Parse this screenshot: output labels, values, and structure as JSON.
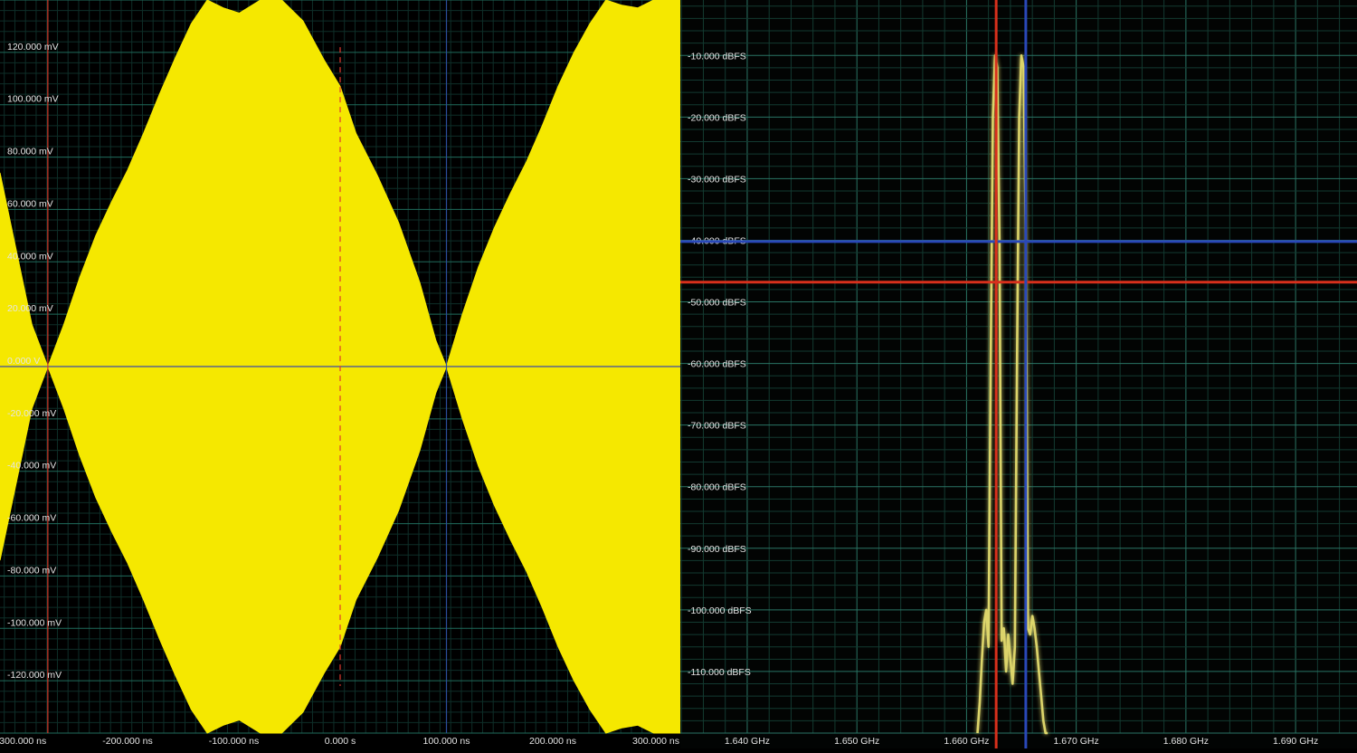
{
  "chart_data": [
    {
      "type": "area",
      "xticks": [
        "-300.000 ns",
        "-200.000 ns",
        "-100.000 ns",
        "0.000 s",
        "100.000 ns",
        "200.000 ns",
        "300.000 ns"
      ],
      "yticks": [
        "120.000 mV",
        "100.000 mV",
        "80.000 mV",
        "60.000 mV",
        "40.000 mV",
        "20.000 mV",
        "0.000 V",
        "-20.000 mV",
        "-40.000 mV",
        "-60.000 mV",
        "-80.000 mV",
        "-100.000 mV",
        "-120.000 mV"
      ],
      "xlim": [
        -320,
        320
      ],
      "ylim": [
        -140,
        140
      ],
      "grid": true,
      "series": [
        {
          "x": [
            -320,
            -290,
            -275,
            -260,
            -245,
            -230,
            -215,
            -200,
            -185,
            -170,
            -155,
            -140,
            -125,
            -110,
            -95,
            -75,
            -55,
            -35,
            -15,
            0,
            15,
            35,
            55,
            75,
            90,
            100,
            115,
            130,
            145,
            160,
            175,
            190,
            205,
            220,
            235,
            250,
            265,
            280,
            295,
            310,
            320
          ],
          "envelope": [
            74,
            16,
            0,
            16,
            34,
            50,
            63,
            75,
            89,
            104,
            118,
            131,
            140,
            137,
            135,
            140,
            140,
            132,
            117,
            107,
            89,
            73,
            55,
            32,
            10,
            0,
            20,
            38,
            53,
            66,
            78,
            92,
            107,
            120,
            131,
            140,
            138,
            137,
            140,
            140,
            140
          ],
          "color": "#f5e800"
        }
      ],
      "markers": {
        "cursor_x": [
          -275,
          0
        ],
        "reference_x": [
          100
        ],
        "cursor_colors": [
          "#d23a2a",
          "#e03a30"
        ]
      }
    },
    {
      "type": "line",
      "xticks": [
        "1.640 GHz",
        "1.650 GHz",
        "1.660 GHz",
        "1.670 GHz",
        "1.680 GHz",
        "1.690 GHz"
      ],
      "yticks": [
        "-10.000 dBFS",
        "-20.000 dBFS",
        "-30.000 dBFS",
        "-40.000 dBFS",
        "-50.000 dBFS",
        "-60.000 dBFS",
        "-70.000 dBFS",
        "-80.000 dBFS",
        "-90.000 dBFS",
        "-100.000 dBFS",
        "-110.000 dBFS"
      ],
      "xlim": [
        1.6339,
        1.6956
      ],
      "ylim": [
        -120,
        -1
      ],
      "grid": true,
      "series": [
        {
          "x": [
            1.661,
            1.6612,
            1.6614,
            1.6616,
            1.6618,
            1.662,
            1.6622,
            1.6624,
            1.6626,
            1.6628,
            1.663,
            1.6632,
            1.6634,
            1.6636,
            1.6638,
            1.664,
            1.6642,
            1.6644,
            1.6646,
            1.6648,
            1.665,
            1.6652,
            1.6654,
            1.6656,
            1.6658,
            1.666,
            1.6662,
            1.6664,
            1.6666,
            1.6668,
            1.667,
            1.6672,
            1.6674
          ],
          "y": [
            -120,
            -115,
            -108,
            -102,
            -100,
            -106,
            -60,
            -20,
            -10,
            -12,
            -40,
            -105,
            -103,
            -110,
            -104,
            -108,
            -112,
            -106,
            -60,
            -20,
            -10,
            -12,
            -40,
            -103,
            -104,
            -101,
            -103,
            -106,
            -110,
            -114,
            -118,
            -120,
            -120
          ],
          "color": "#e8e070"
        }
      ],
      "markers": {
        "vertical": [
          {
            "x": 1.6627,
            "color": "#d8301c"
          },
          {
            "x": 1.6654,
            "color": "#2a48b8"
          }
        ],
        "horizontal": [
          {
            "y": -40.2,
            "color": "#2a48b8"
          },
          {
            "y": -46.8,
            "color": "#d8301c"
          }
        ]
      }
    }
  ]
}
